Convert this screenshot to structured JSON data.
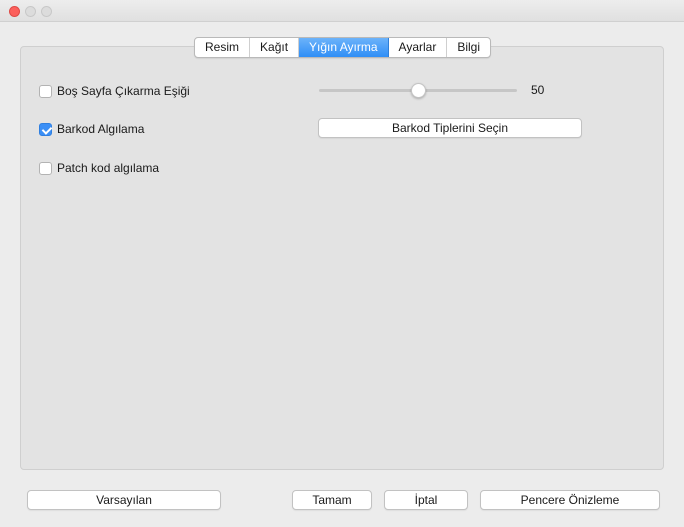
{
  "window": {
    "traffic_lights": [
      "close",
      "minimize",
      "zoom"
    ]
  },
  "tabs": [
    {
      "label": "Resim",
      "active": false
    },
    {
      "label": "Kağıt",
      "active": false
    },
    {
      "label": "Yığın Ayırma",
      "active": true
    },
    {
      "label": "Ayarlar",
      "active": false
    },
    {
      "label": "Bilgi",
      "active": false
    }
  ],
  "options": {
    "blank_page": {
      "label": "Boş Sayfa Çıkarma Eşiği",
      "checked": false
    },
    "barcode": {
      "label": "Barkod Algılama",
      "checked": true
    },
    "patch": {
      "label": "Patch kod algılama",
      "checked": false
    }
  },
  "threshold_slider": {
    "value": "50",
    "fraction": 0.5
  },
  "barcode_types_button": "Barkod Tiplerini Seçin",
  "footer": {
    "defaults_label": "Varsayılan",
    "ok_label": "Tamam",
    "cancel_label": "İptal",
    "preview_label": "Pencere Önizleme"
  },
  "colors": {
    "accent": "#3b8ff6",
    "close_button": "#fc605c",
    "panel_background": "#e3e3e3"
  }
}
